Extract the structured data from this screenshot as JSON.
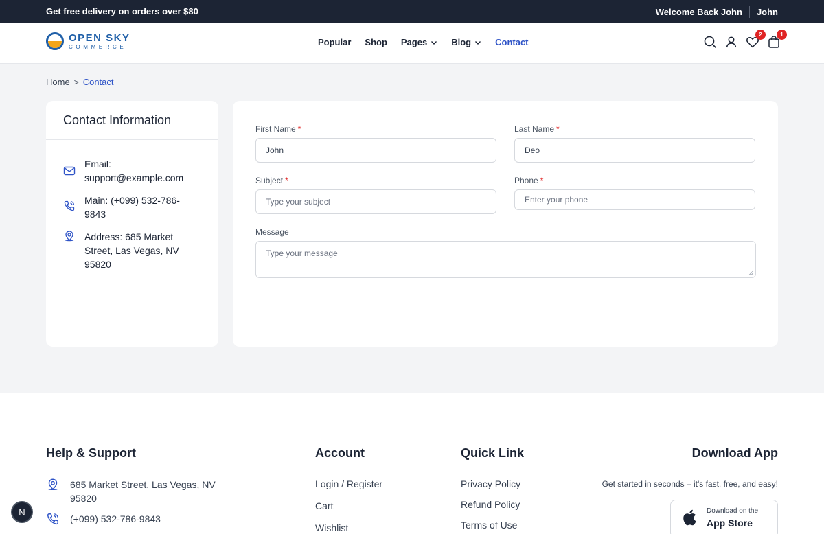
{
  "topbar": {
    "promo": "Get free delivery on orders over $80",
    "welcome": "Welcome Back John",
    "user": "John"
  },
  "brand": {
    "line1": "OPEN SKY",
    "line2": "COMMERCE"
  },
  "nav": {
    "items": [
      {
        "label": "Popular"
      },
      {
        "label": "Shop"
      },
      {
        "label": "Pages"
      },
      {
        "label": "Blog"
      },
      {
        "label": "Contact"
      }
    ],
    "active": "Contact"
  },
  "header_icons": {
    "wishlist_count": "2",
    "cart_count": "1"
  },
  "breadcrumb": {
    "home": "Home",
    "separator": ">",
    "current": "Contact"
  },
  "contact_info": {
    "title": "Contact Information",
    "email": "Email: support@example.com",
    "phone": "Main: (+099) 532-786-9843",
    "address": "Address: 685 Market Street, Las Vegas, NV 95820"
  },
  "form": {
    "first_name": {
      "label": "First Name",
      "value": "John",
      "required": "*"
    },
    "last_name": {
      "label": "Last Name",
      "value": "Deo",
      "required": "*"
    },
    "subject": {
      "label": "Subject",
      "placeholder": "Type your subject",
      "required": "*"
    },
    "phone": {
      "label": "Phone",
      "placeholder": "Enter your phone",
      "required": "*"
    },
    "message": {
      "label": "Message",
      "placeholder": "Type your message"
    }
  },
  "footer": {
    "help": {
      "title": "Help & Support",
      "address": "685 Market Street, Las Vegas, NV 95820",
      "phone": "(+099) 532-786-9843"
    },
    "account": {
      "title": "Account",
      "links": [
        "Login / Register",
        "Cart",
        "Wishlist"
      ]
    },
    "quick": {
      "title": "Quick Link",
      "links": [
        "Privacy Policy",
        "Refund Policy",
        "Terms of Use"
      ]
    },
    "download": {
      "title": "Download App",
      "tagline": "Get started in seconds – it's fast, free, and easy!",
      "store_small": "Download on the",
      "store_big": "App Store"
    }
  },
  "floating_button": {
    "label": "N"
  },
  "colors": {
    "dark": "#1c2434",
    "accent": "#2f54c7",
    "brand": "#1f5fa8",
    "sun": "#f2a51a",
    "badge": "#e02424"
  }
}
